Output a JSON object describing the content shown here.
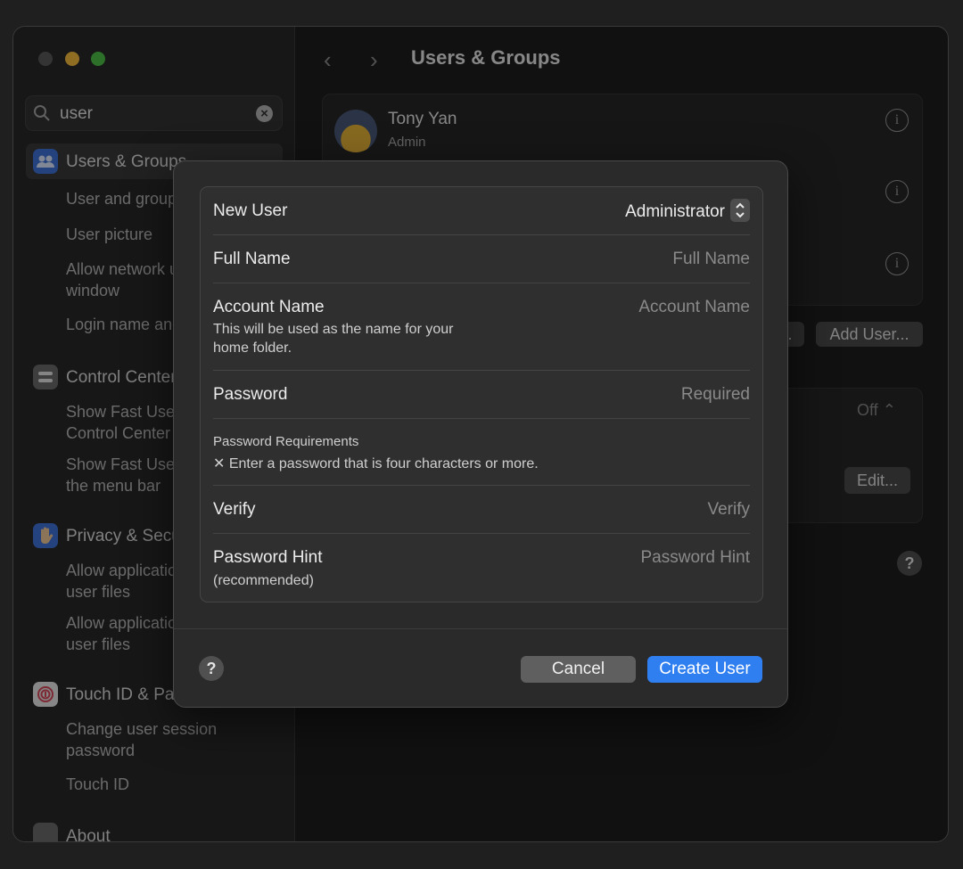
{
  "window": {
    "title": "Users & Groups"
  },
  "search": {
    "value": "user"
  },
  "sidebar": {
    "sections": [
      {
        "label": "Users & Groups",
        "color": "#3f73d8",
        "items": [
          "User and groups",
          "User picture",
          "Allow network users at login window",
          "Login name and password"
        ]
      },
      {
        "label": "Control Center",
        "color": "#707070",
        "items": [
          "Show Fast User Switching in Control Center",
          "Show Fast User Switching in the menu bar"
        ]
      },
      {
        "label": "Privacy & Security",
        "color": "#3f73d8",
        "items": [
          "Allow applications to access all user files",
          "Allow applications to access user files"
        ]
      },
      {
        "label": "Touch ID & Password",
        "color": "#d8485a",
        "items": [
          "Change user session password",
          "Touch ID"
        ]
      },
      {
        "label": "About",
        "color": "#707070",
        "items": []
      }
    ]
  },
  "users": [
    {
      "name": "Tony Yan",
      "role": "Admin"
    }
  ],
  "main": {
    "add_user_label": "Add User...",
    "off_label": "Off",
    "edit_label": "Edit..."
  },
  "dialog": {
    "new_user_label": "New User",
    "new_user_type": "Administrator",
    "full_name_label": "Full Name",
    "full_name_placeholder": "Full Name",
    "account_name_label": "Account Name",
    "account_name_desc": "This will be used as the name for your home folder.",
    "account_name_placeholder": "Account Name",
    "password_label": "Password",
    "password_placeholder": "Required",
    "requirements_title": "Password Requirements",
    "requirement_item": "Enter a password that is four characters or more.",
    "verify_label": "Verify",
    "verify_placeholder": "Verify",
    "hint_label": "Password Hint",
    "hint_sub": "(recommended)",
    "hint_placeholder": "Password Hint",
    "cancel_label": "Cancel",
    "create_label": "Create User",
    "accent": "#2f7ff0"
  }
}
